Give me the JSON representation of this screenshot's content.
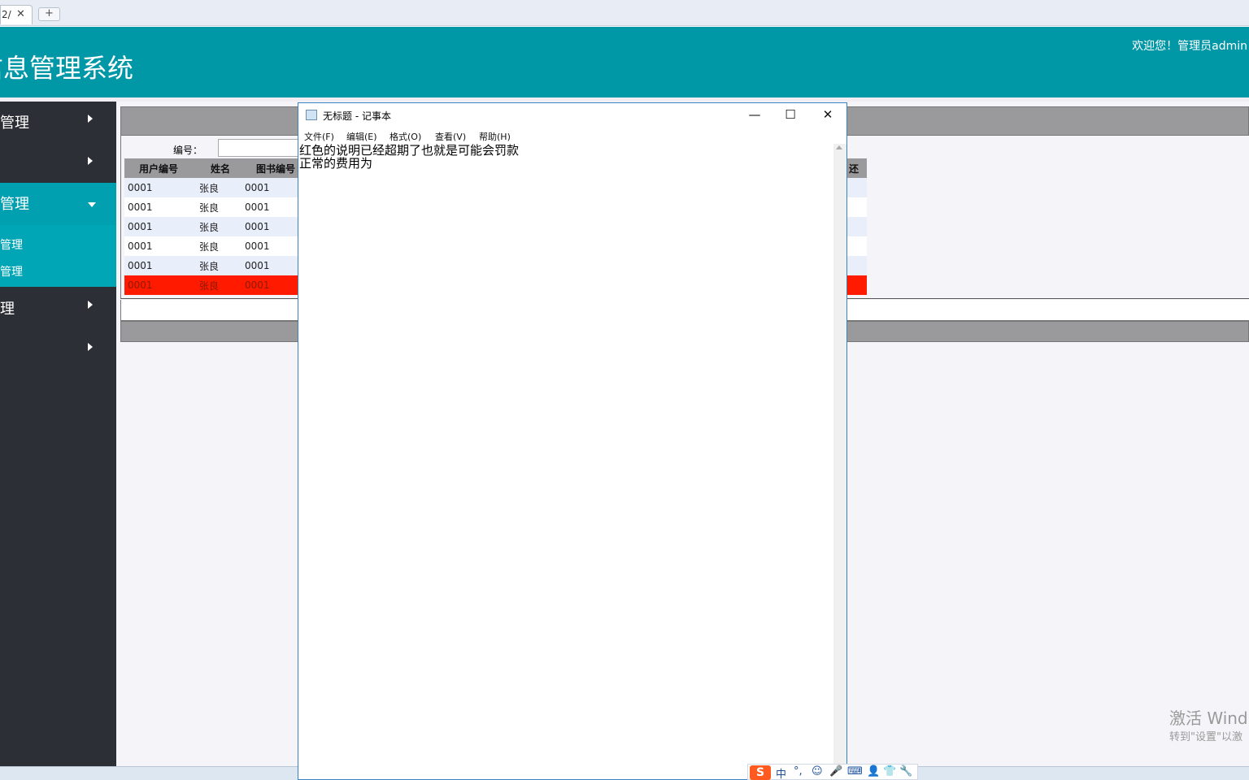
{
  "browser": {
    "tab_label": "2/",
    "tab_close": "✕",
    "new_tab": "+"
  },
  "header": {
    "title": "信息管理系统",
    "welcome": "欢迎您！管理员admin"
  },
  "sidebar": {
    "items": [
      {
        "label": "管理"
      },
      {
        "label": ""
      },
      {
        "label": "管理"
      },
      {
        "label": "理"
      },
      {
        "label": ""
      }
    ],
    "submenu": [
      "管理",
      "管理"
    ]
  },
  "search": {
    "label": "编号：",
    "value": ""
  },
  "table": {
    "headers": [
      "用户编号",
      "姓名",
      "图书编号",
      "还"
    ],
    "rows": [
      {
        "user_id": "0001",
        "name": "张良",
        "book_id": "0001",
        "overdue": false
      },
      {
        "user_id": "0001",
        "name": "张良",
        "book_id": "0001",
        "overdue": false
      },
      {
        "user_id": "0001",
        "name": "张良",
        "book_id": "0001",
        "overdue": false
      },
      {
        "user_id": "0001",
        "name": "张良",
        "book_id": "0001",
        "overdue": false
      },
      {
        "user_id": "0001",
        "name": "张良",
        "book_id": "0001",
        "overdue": false
      },
      {
        "user_id": "0001",
        "name": "张良",
        "book_id": "0001",
        "overdue": true
      }
    ],
    "overdue_color": "#ff1a00"
  },
  "notepad": {
    "title": "无标题 - 记事本",
    "minimize": "—",
    "maximize": "☐",
    "close": "✕",
    "menus": [
      "文件(F)",
      "编辑(E)",
      "格式(O)",
      "查看(V)",
      "帮助(H)"
    ],
    "text": "红色的说明已经超期了也就是可能会罚款\n正常的费用为"
  },
  "watermark": {
    "line1": "激活 Wind",
    "line2": "转到\"设置\"以激"
  },
  "ime": {
    "logo": "S",
    "mode": "中",
    "items": [
      "°,",
      "☺",
      "🎤",
      "⌨",
      "👤",
      "👕",
      "🔧"
    ]
  },
  "colors": {
    "header": "#0097a7",
    "sidebar": "#2d2f36",
    "sidebar_active": "#00a0b0"
  }
}
